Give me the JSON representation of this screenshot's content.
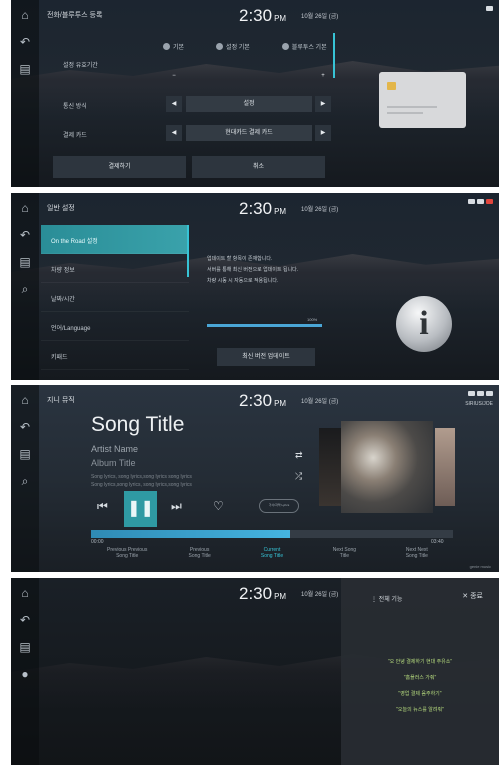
{
  "clock": {
    "time": "2:30",
    "ampm": "PM",
    "date": "10월 26일 (금)"
  },
  "screen1": {
    "title": "전화/블루투스 등록",
    "radio_options": [
      "기본",
      "설정 기본",
      "블루투스 기본"
    ],
    "label_period": "설정 유효기간",
    "label_mode": "통신 방식",
    "mode_value": "설정",
    "label_card": "결제 카드",
    "card_value": "현대카드 결제 카드",
    "confirm_label": "결제하기",
    "cancel_label": "취소"
  },
  "screen2": {
    "title": "일반 설정",
    "menu": [
      "On the Road 설정",
      "차량 정보",
      "날짜/시간",
      "언어/Language",
      "키패드"
    ],
    "message_lines": [
      "업데이트 할 항목이 존재합니다.",
      "서버를 통해 최신 버전으로 업데이트 됩니다.",
      "차량 시동 시 자동으로 적용됩니다."
    ],
    "progress_value": 100,
    "progress_text": "100%",
    "update_button": "최신 버전 업데이트",
    "info_glyph": "i"
  },
  "screen3": {
    "title": "지니 뮤직",
    "song_title": "Song Title",
    "artist": "Artist Name",
    "album": "Album Title",
    "lyrics": [
      "Song lyrics, song lyrics,song lyrics song lyrics",
      "Song lyrics,song lyrics, song lyrics,song lyrics"
    ],
    "progress": 0.55,
    "time_start": "00:00",
    "time_end": "03:40",
    "pill": "가사/자막 Lyrics",
    "status_text": "SIRIUS/JOE",
    "watermark": "genie music",
    "queue": [
      {
        "line1": "Previous Previous",
        "line2": "Song Title",
        "current": false
      },
      {
        "line1": "Previous",
        "line2": "Song Title",
        "current": false
      },
      {
        "line1": "Current",
        "line2": "Song Title",
        "current": true
      },
      {
        "line1": "Next Song",
        "line2": "Title",
        "current": false
      },
      {
        "line1": "Next Next",
        "line2": "Song Title",
        "current": false
      }
    ]
  },
  "screen4": {
    "side_title": "전체 기능",
    "close_label": "종료",
    "hints": [
      "\"오 안녕 결제하기 현대 주유소\"",
      "\"홈플러스 가줘\"",
      "\"영업 결제 음주하기\"",
      "\"오늘의 뉴스를 알려줘\""
    ]
  }
}
